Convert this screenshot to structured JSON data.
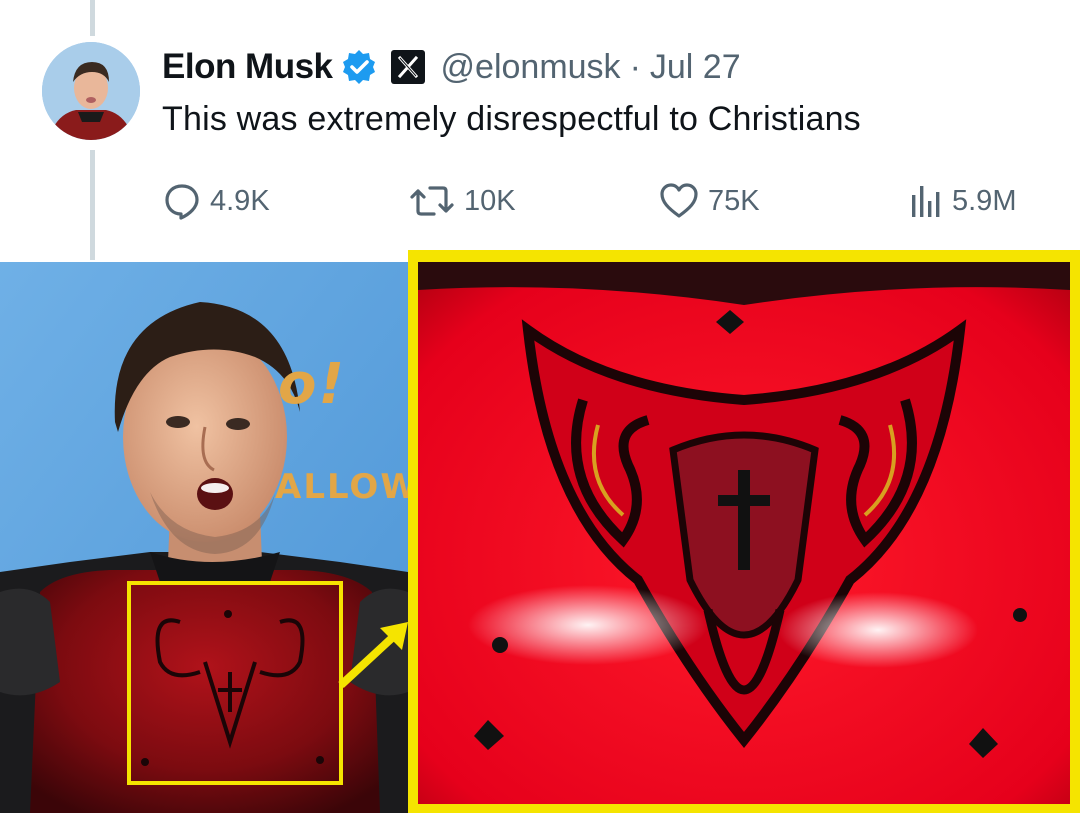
{
  "tweet": {
    "author_name": "Elon Musk",
    "handle": "@elonmusk",
    "separator": "·",
    "date": "Jul 27",
    "text": "This was extremely disrespectful to Christians",
    "verified_icon": "verified-badge-icon",
    "affiliation_icon": "x-logo-icon",
    "actions": {
      "replies": "4.9K",
      "reposts": "10K",
      "likes": "75K",
      "views": "5.9M"
    }
  },
  "photo": {
    "backdrop_text_1": "o! ",
    "backdrop_text_2": "ALLOW",
    "highlight_color": "#f5e400",
    "armor_color": "#e0001b"
  },
  "colors": {
    "text_primary": "#0f1419",
    "text_secondary": "#536471",
    "verified_blue": "#1d9bf0",
    "thread_line": "#cfd9de"
  }
}
